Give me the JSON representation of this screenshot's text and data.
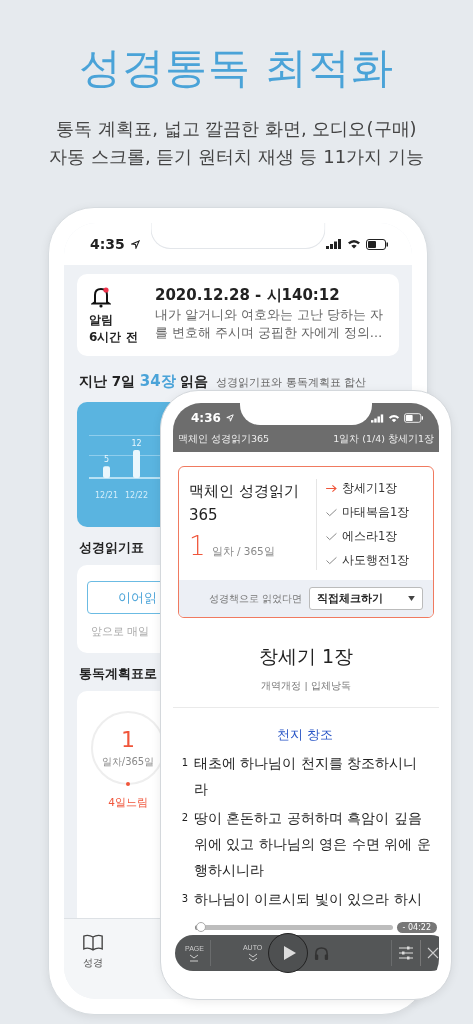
{
  "headline": "성경통독 최적화",
  "subtitle": [
    "통독 계획표, 넓고 깔끔한 화면, 오디오(구매)",
    "자동 스크롤, 듣기 원터치 재생 등 11가지 기능"
  ],
  "back_phone": {
    "status_time": "4:35",
    "notification": {
      "label": "알림",
      "time": "6시간 전",
      "unread": true,
      "title": "2020.12.28 - 시140:12",
      "body": "내가 알거니와 여호와는 고난 당하는 자를 변호해 주시며 궁핍한 자에게 정의…"
    },
    "summary": {
      "prefix": "지난 7일",
      "count": "34장",
      "suffix": "읽음",
      "note": "성경읽기표와 통독계획표 합산"
    },
    "weekly_chart": {
      "chart_data": {
        "type": "bar",
        "categories": [
          "12/21",
          "12/22"
        ],
        "values": [
          5,
          12
        ],
        "data_labels": true
      }
    },
    "reading_table": {
      "title": "성경읽기표",
      "button": "이어읽",
      "hint": "앞으로 매일"
    },
    "plan_section": {
      "title": "통독계획표로",
      "plans": [
        {
          "day": "1",
          "unit": "일차/365일",
          "status": "4일느림",
          "color": "#f0553a"
        }
      ]
    },
    "tab_bar": [
      {
        "label": "성경",
        "selected": false
      }
    ]
  },
  "front_phone": {
    "status_time": "4:36",
    "header_left": "맥체인 성경읽기365",
    "header_right": "1일차 (1/4) 창세기1장",
    "plan_card": {
      "title": "맥체인 성경읽기",
      "subtitle": "365",
      "day": "1",
      "day_unit": "일차 / 365일",
      "readings": [
        {
          "label": "창세기1장",
          "selected": true
        },
        {
          "label": "마태복음1장",
          "selected": false
        },
        {
          "label": "에스라1장",
          "selected": false
        },
        {
          "label": "사도행전1장",
          "selected": false
        }
      ],
      "paper_label": "성경책으로 읽었다면",
      "select_value": "직접체크하기"
    },
    "chapter": {
      "title": "창세기 1장",
      "version": "개역개정 | 입체낭독",
      "heading": "천지 창조",
      "verses": [
        {
          "number": "1",
          "text": "태초에 하나님이 천지를 창조하시니라"
        },
        {
          "number": "2",
          "text": "땅이 혼돈하고 공허하며 흑암이 깊음 위에 있고 하나님의 영은 수면 위에 운행하시니라"
        },
        {
          "number": "3",
          "text": "하나님이 이르시되 빛이 있으라 하시"
        }
      ]
    },
    "player": {
      "level": 0.03,
      "remaining": "- 04:22",
      "page_label": "PAGE",
      "auto_label": "AUTO"
    }
  }
}
